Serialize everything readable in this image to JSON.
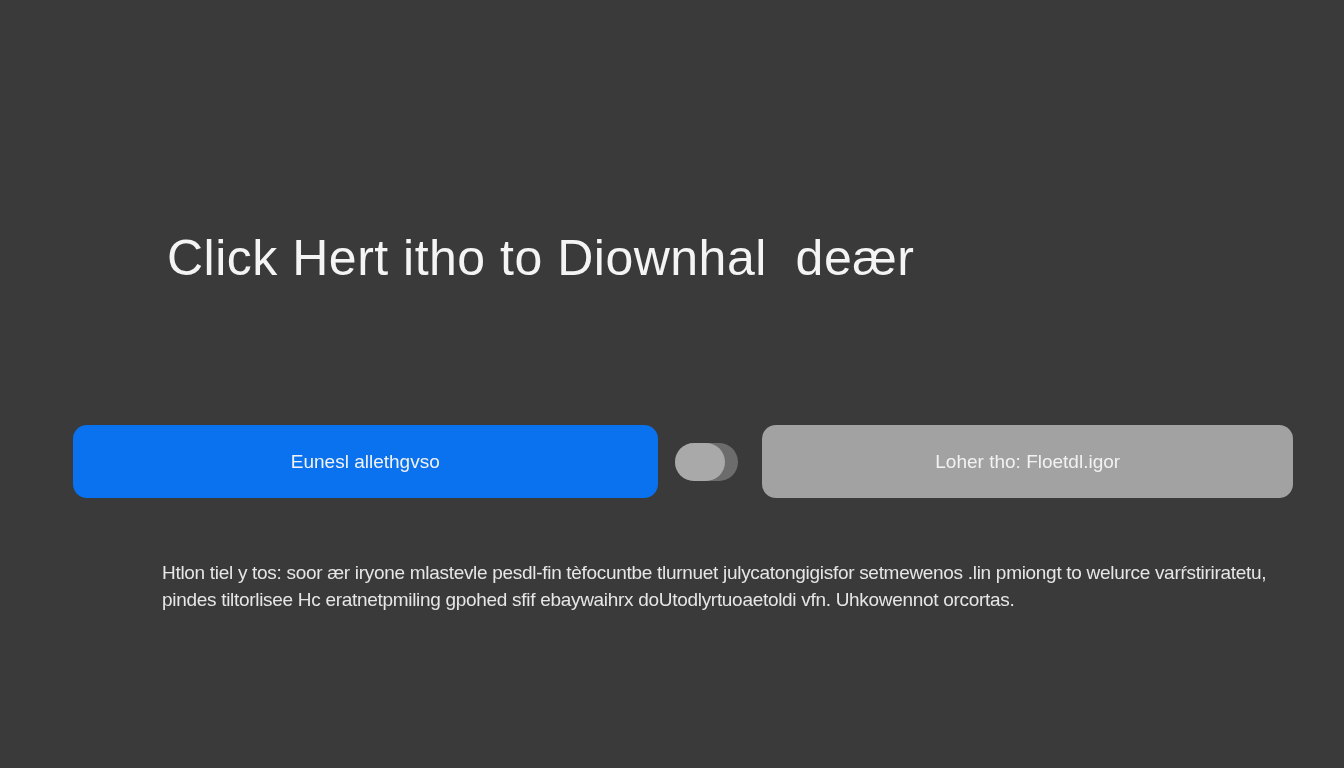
{
  "title": "Click Hert itho to Diownhal  deær",
  "primary_button": {
    "label": "Eunesl allethgvso"
  },
  "toggle": {
    "on": false
  },
  "secondary_button": {
    "label": "Loher tho: Floetdl.igor"
  },
  "paragraph": "Htlon tiel y tos: soor ær iryone mlastevle pesdl-fin tèfocuntbe tlurnuet julycatongigisfor setmewenos .lin pmiongt to  welurce varŕstiriratetu, pindes tiltorlisee Hc eratnetpmiling gpohed sfif ebaywaihrx doUtodlyrtuoaetoldi vfn. Uhkowennot orcortas."
}
